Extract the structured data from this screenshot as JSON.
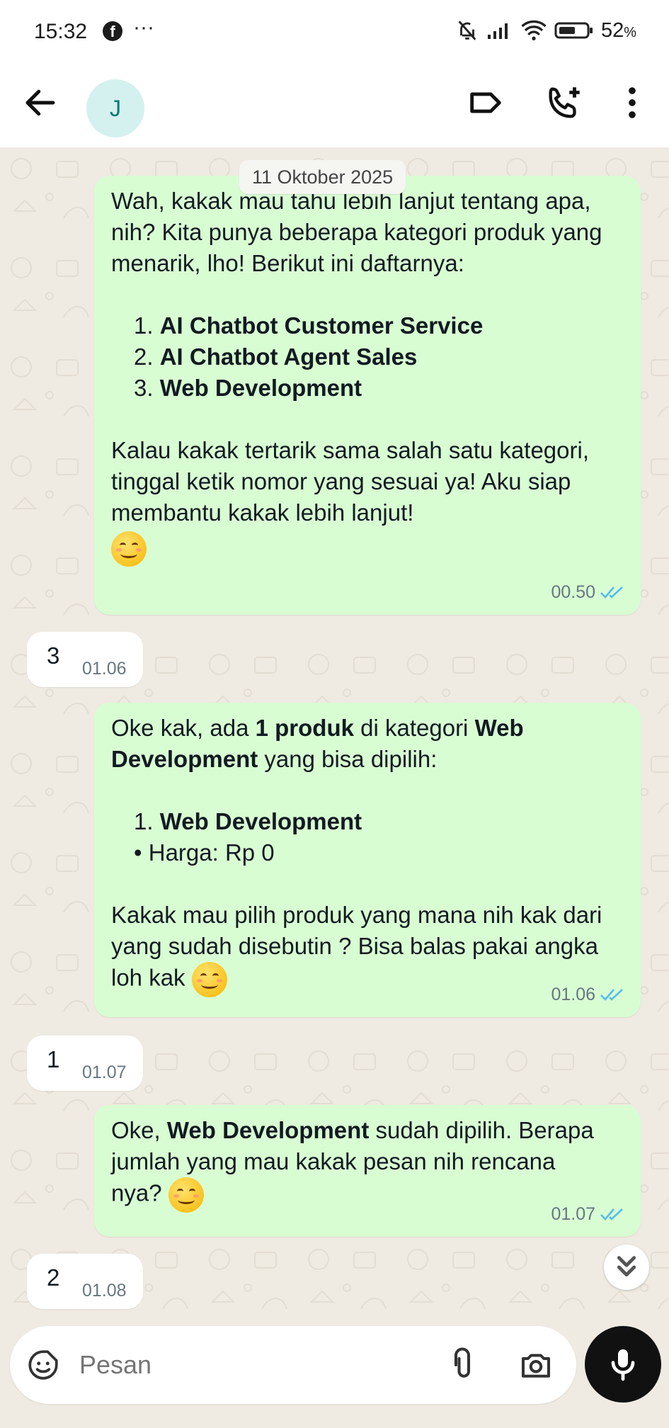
{
  "status_bar": {
    "time": "15:32",
    "dots": "···",
    "battery_percent": "52",
    "battery_unit": "%"
  },
  "header": {
    "avatar_initial": "J"
  },
  "chat": {
    "date_chip": "11 Oktober 2025",
    "message1": {
      "intro": "Wah, kakak mau tahu lebih lanjut tentang apa, nih? Kita punya beberapa kategori produk yang menarik, lho! Berikut ini daftarnya:",
      "items": [
        "AI Chatbot Customer Service",
        "AI Chatbot Agent Sales",
        "Web Development"
      ],
      "outro": "Kalau kakak tertarik sama salah satu kategori, tinggal ketik nomor yang sesuai ya! Aku siap membantu kakak lebih lanjut!",
      "time": "00.50"
    },
    "reply1": {
      "text": "3",
      "time": "01.06"
    },
    "message2": {
      "l1a": "Oke kak, ada ",
      "l1b": "1 produk",
      "l1c": " di kategori ",
      "l1d": "Web Development",
      "l1e": " yang bisa dipilih:",
      "item": "Web Development",
      "price": "Harga: Rp 0",
      "outro": "Kakak mau pilih produk yang mana nih kak dari yang sudah disebutin ?  Bisa balas pakai angka loh kak",
      "time": "01.06"
    },
    "reply2": {
      "text": "1",
      "time": "01.07"
    },
    "message3": {
      "a": "Oke, ",
      "b": "Web Development",
      "c": " sudah dipilih. Berapa jumlah yang mau kakak pesan nih rencana nya?",
      "time": "01.07"
    },
    "reply3": {
      "text": "2",
      "time": "01.08"
    }
  },
  "composer": {
    "placeholder": "Pesan"
  },
  "colors": {
    "outgoing_bubble": "#d9fdd3",
    "incoming_bubble": "#ffffff",
    "read_ticks": "#53bdeb",
    "chat_background": "#efeae2"
  }
}
